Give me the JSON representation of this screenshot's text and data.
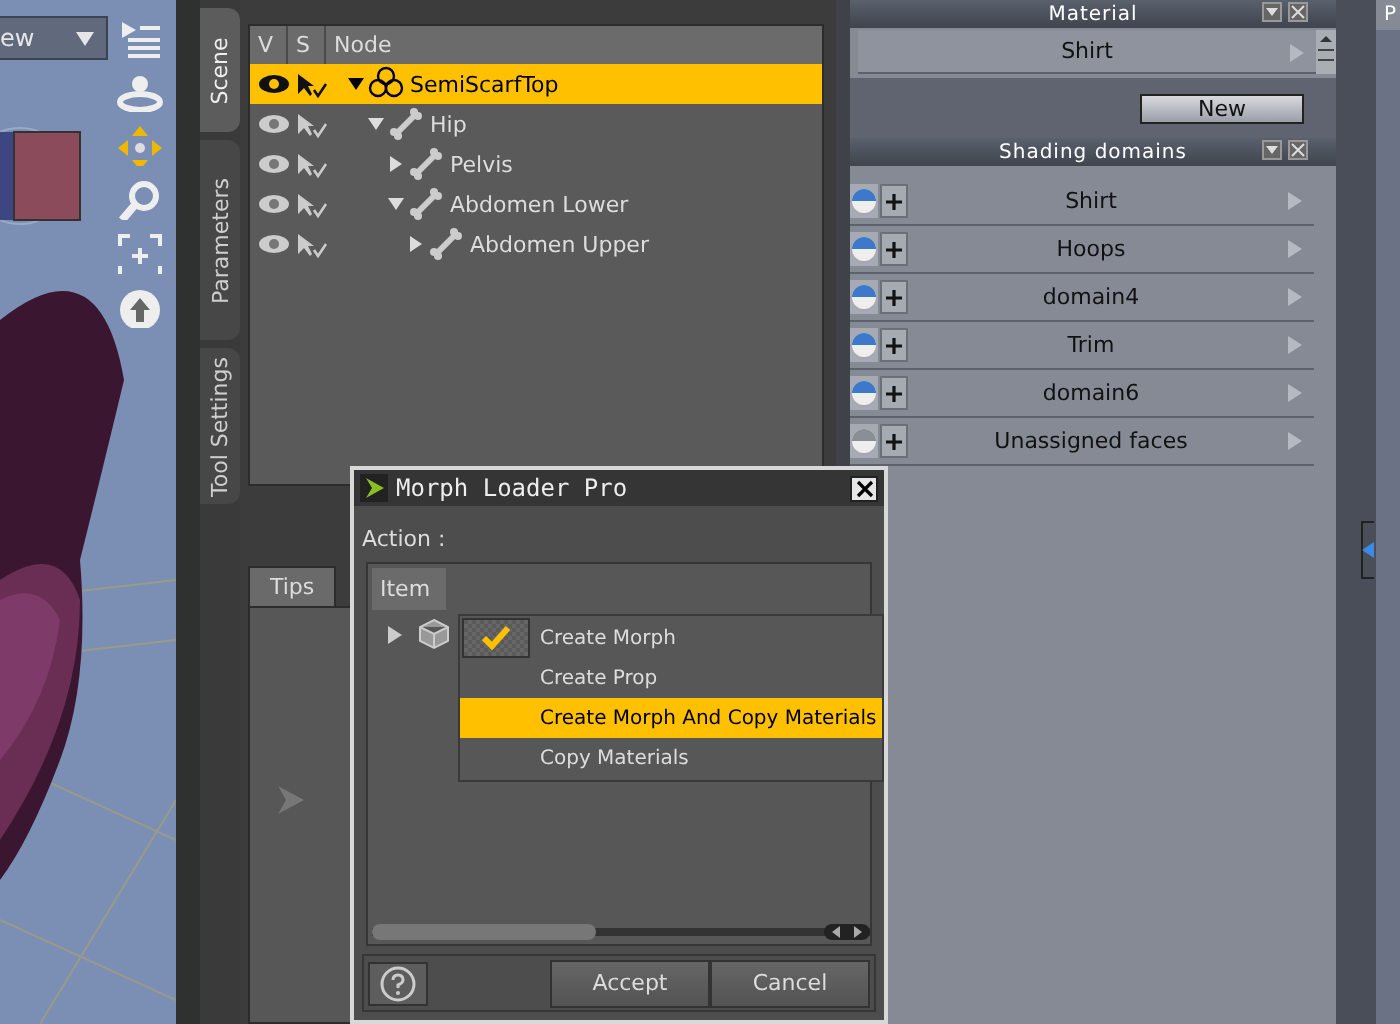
{
  "viewport": {
    "view_menu": "ew"
  },
  "side_tabs": [
    {
      "label": "Scene",
      "selected": true
    },
    {
      "label": "Parameters",
      "selected": false
    },
    {
      "label": "Tool Settings",
      "selected": false
    }
  ],
  "scene": {
    "columns": [
      "V",
      "S",
      "Node"
    ],
    "nodes": [
      {
        "label": "SemiScarfTop",
        "kind": "figure",
        "selected": true,
        "expanded": true,
        "children": [
          {
            "label": "Hip",
            "kind": "bone",
            "selected": false,
            "expanded": true,
            "children": [
              {
                "label": "Pelvis",
                "kind": "bone",
                "selected": false,
                "expanded": false
              },
              {
                "label": "Abdomen Lower",
                "kind": "bone",
                "selected": false,
                "expanded": true,
                "children": [
                  {
                    "label": "Abdomen Upper",
                    "kind": "bone",
                    "selected": false,
                    "expanded": false
                  }
                ]
              }
            ]
          }
        ]
      }
    ]
  },
  "bottom_tabs": [
    {
      "label": "Tips",
      "selected": true
    }
  ],
  "material": {
    "title": "Material",
    "value": "Shirt",
    "button": "New"
  },
  "shading_domains": {
    "title": "Shading domains",
    "items": [
      {
        "label": "Shirt",
        "kind": "assigned"
      },
      {
        "label": "Hoops",
        "kind": "assigned"
      },
      {
        "label": "domain4",
        "kind": "assigned"
      },
      {
        "label": "Trim",
        "kind": "assigned"
      },
      {
        "label": "domain6",
        "kind": "assigned"
      },
      {
        "label": "Unassigned faces",
        "kind": "unassigned"
      }
    ]
  },
  "edge_label": "P",
  "dialog": {
    "title": "Morph Loader Pro",
    "action_label": "Action :",
    "options": [
      {
        "label": "Create Morph",
        "checked": true,
        "selected": false
      },
      {
        "label": "Create Prop",
        "checked": false,
        "selected": false
      },
      {
        "label": "Create Morph And Copy Materials",
        "checked": false,
        "selected": true
      },
      {
        "label": "Copy Materials",
        "checked": false,
        "selected": false
      }
    ],
    "columns": [
      "Item"
    ],
    "buttons": [
      "Accept",
      "Cancel"
    ]
  }
}
